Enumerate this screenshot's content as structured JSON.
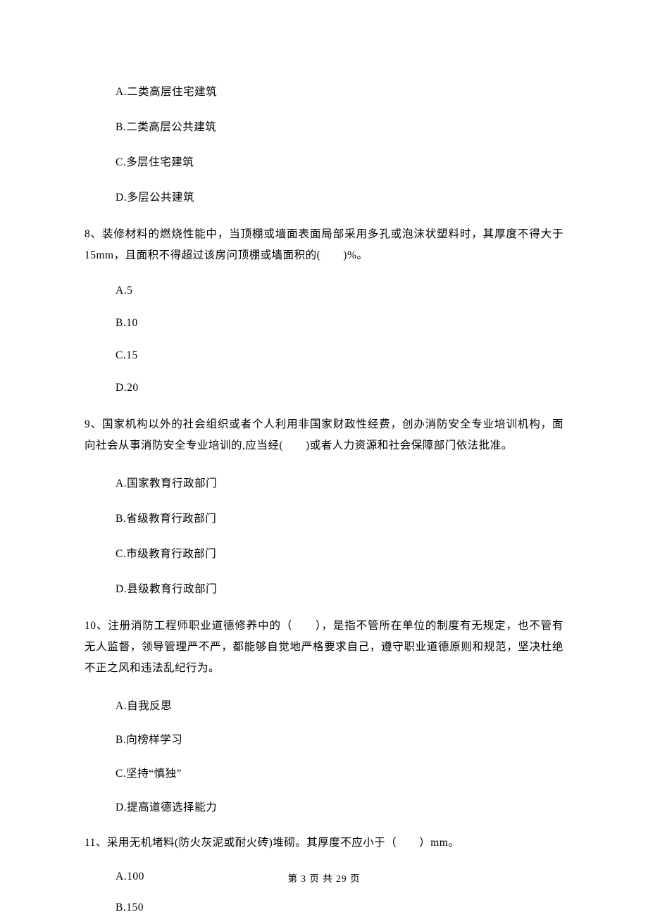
{
  "q7_options": {
    "a": "A.二类高层住宅建筑",
    "b": "B.二类高层公共建筑",
    "c": "C.多层住宅建筑",
    "d": "D.多层公共建筑"
  },
  "q8": {
    "text": "8、装修材料的燃烧性能中，当顶棚或墙面表面局部采用多孔或泡沫状塑料时，其厚度不得大于15mm，且面积不得超过该房问顶棚或墙面积的(　　)%。",
    "a": "A.5",
    "b": "B.10",
    "c": "C.15",
    "d": "D.20"
  },
  "q9": {
    "text": "9、国家机构以外的社会组织或者个人利用非国家财政性经费，创办消防安全专业培训机构，面向社会从事消防安全专业培训的,应当经(　　)或者人力资源和社会保障部门依法批准。",
    "a": "A.国家教育行政部门",
    "b": "B.省级教育行政部门",
    "c": "C.市级教育行政部门",
    "d": "D.县级教育行政部门"
  },
  "q10": {
    "text": "10、注册消防工程师职业道德修养中的（　　），是指不管所在单位的制度有无规定，也不管有无人监督，领导管理严不严，都能够自觉地严格要求自己，遵守职业道德原则和规范，坚决杜绝不正之风和违法乱纪行为。",
    "a": "A.自我反思",
    "b": "B.向榜样学习",
    "c": "C.坚持“慎独”",
    "d": "D.提高道德选择能力"
  },
  "q11": {
    "text": "11、采用无机堵料(防火灰泥或耐火砖)堆砌。其厚度不应小于（　　）mm。",
    "a": "A.100",
    "b": "B.150"
  },
  "footer": "第 3 页 共 29 页"
}
